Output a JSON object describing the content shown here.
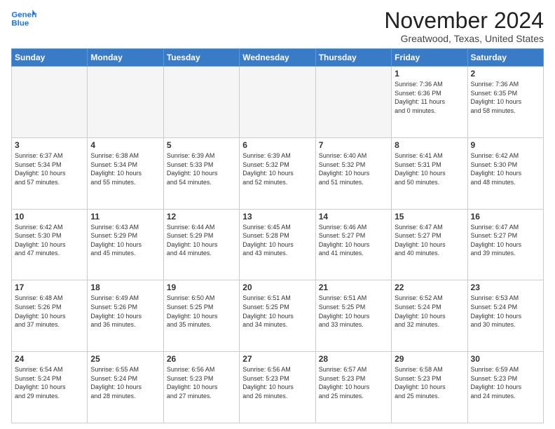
{
  "header": {
    "logo_line1": "General",
    "logo_line2": "Blue",
    "month": "November 2024",
    "location": "Greatwood, Texas, United States"
  },
  "weekdays": [
    "Sunday",
    "Monday",
    "Tuesday",
    "Wednesday",
    "Thursday",
    "Friday",
    "Saturday"
  ],
  "weeks": [
    [
      {
        "day": "",
        "info": ""
      },
      {
        "day": "",
        "info": ""
      },
      {
        "day": "",
        "info": ""
      },
      {
        "day": "",
        "info": ""
      },
      {
        "day": "",
        "info": ""
      },
      {
        "day": "1",
        "info": "Sunrise: 7:36 AM\nSunset: 6:36 PM\nDaylight: 11 hours\nand 0 minutes."
      },
      {
        "day": "2",
        "info": "Sunrise: 7:36 AM\nSunset: 6:35 PM\nDaylight: 10 hours\nand 58 minutes."
      }
    ],
    [
      {
        "day": "3",
        "info": "Sunrise: 6:37 AM\nSunset: 5:34 PM\nDaylight: 10 hours\nand 57 minutes."
      },
      {
        "day": "4",
        "info": "Sunrise: 6:38 AM\nSunset: 5:34 PM\nDaylight: 10 hours\nand 55 minutes."
      },
      {
        "day": "5",
        "info": "Sunrise: 6:39 AM\nSunset: 5:33 PM\nDaylight: 10 hours\nand 54 minutes."
      },
      {
        "day": "6",
        "info": "Sunrise: 6:39 AM\nSunset: 5:32 PM\nDaylight: 10 hours\nand 52 minutes."
      },
      {
        "day": "7",
        "info": "Sunrise: 6:40 AM\nSunset: 5:32 PM\nDaylight: 10 hours\nand 51 minutes."
      },
      {
        "day": "8",
        "info": "Sunrise: 6:41 AM\nSunset: 5:31 PM\nDaylight: 10 hours\nand 50 minutes."
      },
      {
        "day": "9",
        "info": "Sunrise: 6:42 AM\nSunset: 5:30 PM\nDaylight: 10 hours\nand 48 minutes."
      }
    ],
    [
      {
        "day": "10",
        "info": "Sunrise: 6:42 AM\nSunset: 5:30 PM\nDaylight: 10 hours\nand 47 minutes."
      },
      {
        "day": "11",
        "info": "Sunrise: 6:43 AM\nSunset: 5:29 PM\nDaylight: 10 hours\nand 45 minutes."
      },
      {
        "day": "12",
        "info": "Sunrise: 6:44 AM\nSunset: 5:29 PM\nDaylight: 10 hours\nand 44 minutes."
      },
      {
        "day": "13",
        "info": "Sunrise: 6:45 AM\nSunset: 5:28 PM\nDaylight: 10 hours\nand 43 minutes."
      },
      {
        "day": "14",
        "info": "Sunrise: 6:46 AM\nSunset: 5:27 PM\nDaylight: 10 hours\nand 41 minutes."
      },
      {
        "day": "15",
        "info": "Sunrise: 6:47 AM\nSunset: 5:27 PM\nDaylight: 10 hours\nand 40 minutes."
      },
      {
        "day": "16",
        "info": "Sunrise: 6:47 AM\nSunset: 5:27 PM\nDaylight: 10 hours\nand 39 minutes."
      }
    ],
    [
      {
        "day": "17",
        "info": "Sunrise: 6:48 AM\nSunset: 5:26 PM\nDaylight: 10 hours\nand 37 minutes."
      },
      {
        "day": "18",
        "info": "Sunrise: 6:49 AM\nSunset: 5:26 PM\nDaylight: 10 hours\nand 36 minutes."
      },
      {
        "day": "19",
        "info": "Sunrise: 6:50 AM\nSunset: 5:25 PM\nDaylight: 10 hours\nand 35 minutes."
      },
      {
        "day": "20",
        "info": "Sunrise: 6:51 AM\nSunset: 5:25 PM\nDaylight: 10 hours\nand 34 minutes."
      },
      {
        "day": "21",
        "info": "Sunrise: 6:51 AM\nSunset: 5:25 PM\nDaylight: 10 hours\nand 33 minutes."
      },
      {
        "day": "22",
        "info": "Sunrise: 6:52 AM\nSunset: 5:24 PM\nDaylight: 10 hours\nand 32 minutes."
      },
      {
        "day": "23",
        "info": "Sunrise: 6:53 AM\nSunset: 5:24 PM\nDaylight: 10 hours\nand 30 minutes."
      }
    ],
    [
      {
        "day": "24",
        "info": "Sunrise: 6:54 AM\nSunset: 5:24 PM\nDaylight: 10 hours\nand 29 minutes."
      },
      {
        "day": "25",
        "info": "Sunrise: 6:55 AM\nSunset: 5:24 PM\nDaylight: 10 hours\nand 28 minutes."
      },
      {
        "day": "26",
        "info": "Sunrise: 6:56 AM\nSunset: 5:23 PM\nDaylight: 10 hours\nand 27 minutes."
      },
      {
        "day": "27",
        "info": "Sunrise: 6:56 AM\nSunset: 5:23 PM\nDaylight: 10 hours\nand 26 minutes."
      },
      {
        "day": "28",
        "info": "Sunrise: 6:57 AM\nSunset: 5:23 PM\nDaylight: 10 hours\nand 25 minutes."
      },
      {
        "day": "29",
        "info": "Sunrise: 6:58 AM\nSunset: 5:23 PM\nDaylight: 10 hours\nand 25 minutes."
      },
      {
        "day": "30",
        "info": "Sunrise: 6:59 AM\nSunset: 5:23 PM\nDaylight: 10 hours\nand 24 minutes."
      }
    ]
  ]
}
